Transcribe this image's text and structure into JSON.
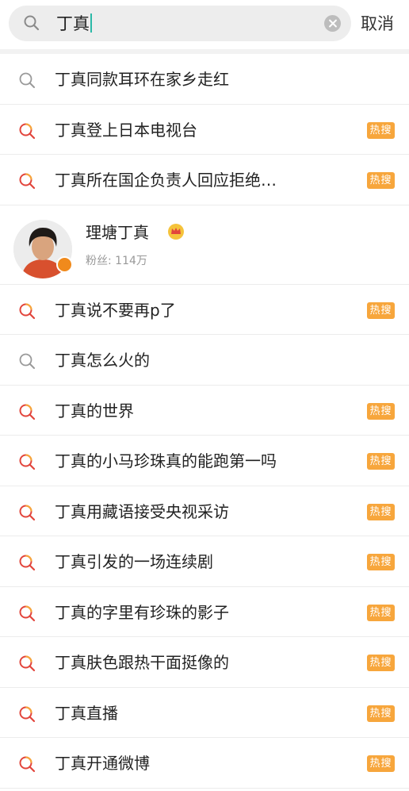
{
  "search": {
    "query": "丁真",
    "cancel_label": "取消"
  },
  "user_card": {
    "name": "理塘丁真",
    "fans": "粉丝: 114万"
  },
  "suggestions": [
    {
      "text": "丁真同款耳环在家乡走红",
      "hot": false,
      "badge": ""
    },
    {
      "text": "丁真登上日本电视台",
      "hot": true,
      "badge": "热搜"
    },
    {
      "text": "丁真所在国企负责人回应拒绝…",
      "hot": true,
      "badge": "热搜"
    },
    {
      "text": "丁真说不要再p了",
      "hot": true,
      "badge": "热搜"
    },
    {
      "text": "丁真怎么火的",
      "hot": false,
      "badge": ""
    },
    {
      "text": "丁真的世界",
      "hot": true,
      "badge": "热搜"
    },
    {
      "text": "丁真的小马珍珠真的能跑第一吗",
      "hot": true,
      "badge": "热搜"
    },
    {
      "text": "丁真用藏语接受央视采访",
      "hot": true,
      "badge": "热搜"
    },
    {
      "text": "丁真引发的一场连续剧",
      "hot": true,
      "badge": "热搜"
    },
    {
      "text": "丁真的字里有珍珠的影子",
      "hot": true,
      "badge": "热搜"
    },
    {
      "text": "丁真肤色跟热干面挺像的",
      "hot": true,
      "badge": "热搜"
    },
    {
      "text": "丁真直播",
      "hot": true,
      "badge": "热搜"
    },
    {
      "text": "丁真开通微博",
      "hot": true,
      "badge": "热搜"
    }
  ],
  "colors": {
    "hot_badge": "#f7a63c",
    "hot_icon_red": "#e2453c",
    "hot_icon_orange": "#f7a63c",
    "search_icon_gray": "#9a9a9a",
    "caret": "#2bb9a8"
  }
}
